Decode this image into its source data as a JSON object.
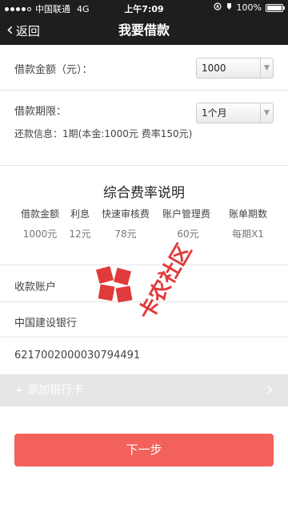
{
  "status_bar": {
    "carrier": "中国联通",
    "network": "4G",
    "time": "上午7:09",
    "battery": "100%"
  },
  "nav": {
    "back_label": "返回",
    "title": "我要借款"
  },
  "loan_amount": {
    "label": "借款金额（元）：",
    "value": "1000"
  },
  "loan_term": {
    "label": "借款期限：",
    "value": "1个月"
  },
  "repayment_info": "还款信息：1期(本金:1000元 费率150元)",
  "fee_section": {
    "title": "综合费率说明",
    "headers": [
      "借款金额",
      "利息",
      "快速审核费",
      "账户管理费",
      "账单期数"
    ],
    "values": [
      "1000元",
      "12元",
      "78元",
      "60元",
      "每期X1"
    ]
  },
  "account": {
    "label": "收款账户",
    "bank": "中国建设银行",
    "card_number": "6217002000030794491"
  },
  "add_card_label": "+ 添加银行卡",
  "next_button": "下一步",
  "watermark_text": "卡农社区",
  "colors": {
    "accent": "#f2615a",
    "bar": "#1e1e1e"
  }
}
